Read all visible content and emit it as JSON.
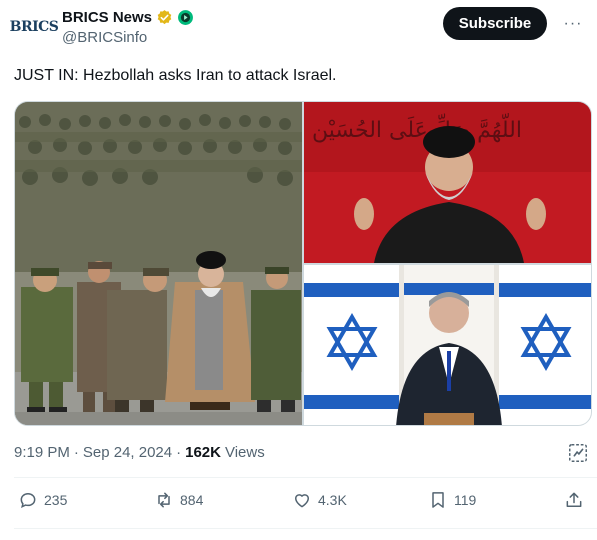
{
  "account": {
    "avatar_text": "BRICS",
    "display_name": "BRICS News",
    "handle": "@BRICSinfo"
  },
  "header": {
    "subscribe_label": "Subscribe",
    "more_label": "···"
  },
  "tweet": {
    "text": "JUST IN: Hezbollah asks Iran to attack Israel."
  },
  "media": {
    "top_right_banner_text": "اللّهُمَّ صَلِّ عَلَى الحُسَيْن"
  },
  "meta": {
    "time": "9:19 PM",
    "separator": "·",
    "date": "Sep 24, 2024",
    "separator2": "·",
    "views_count": "162K",
    "views_label": "Views"
  },
  "stats": {
    "replies": "235",
    "reposts": "884",
    "likes": "4.3K",
    "bookmarks": "119"
  },
  "icons": {
    "verified": "gold-check-badge",
    "affiliate": "green-circle-badge",
    "reply": "speech-bubble-icon",
    "repost": "repost-arrows-icon",
    "like": "heart-icon",
    "bookmark": "bookmark-icon",
    "share": "share-icon",
    "views": "grok-analytics-icon"
  },
  "colors": {
    "text": "#0f1419",
    "muted": "#536471",
    "button_bg": "#0f1419",
    "verified_gold": "#e2b719",
    "affiliate_green": "#00ba7c",
    "israel_blue": "#1f5fbf",
    "banner_red": "#c21a22"
  }
}
